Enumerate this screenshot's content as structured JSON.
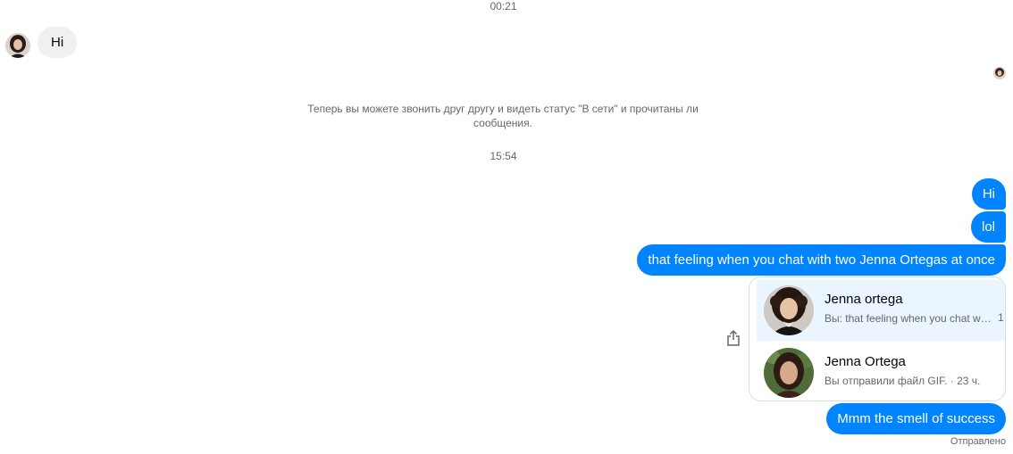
{
  "timestamps": {
    "first": "00:21",
    "second": "15:54"
  },
  "incoming": {
    "text": "Hi"
  },
  "system_notice": "Теперь вы можете звонить друг другу и видеть статус \"В сети\" и прочитаны ли сообщения.",
  "outgoing": {
    "msg1": "Hi",
    "msg2": "lol",
    "msg3": "that feeling when you chat with two Jenna Ortegas at once",
    "msg4": "Mmm the smell of success"
  },
  "contacts": [
    {
      "name": "Jenna ortega",
      "subtitle": "Вы: that feeling when you chat with two Jenna Ortegas at once",
      "extra": "1"
    },
    {
      "name": "Jenna Ortega",
      "subtitle": "Вы отправили файл GIF. · 23 ч."
    }
  ],
  "status": "Отправлено",
  "colors": {
    "accent": "#0084ff",
    "incoming_bubble": "#f0f0f0",
    "highlight_row": "#ebf5ff",
    "muted_text": "#65676b"
  },
  "icons": {
    "share": "share-icon"
  }
}
